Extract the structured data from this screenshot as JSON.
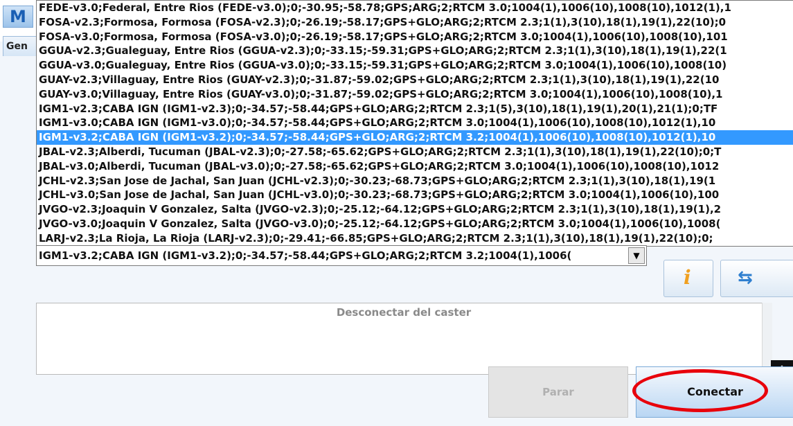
{
  "app": {
    "icon_letter": "M",
    "side_tab_label": "Gen"
  },
  "mountpoint_list": {
    "items": [
      "FEDE-v3.0;Federal, Entre Rios (FEDE-v3.0);0;-30.95;-58.78;GPS;ARG;2;RTCM 3.0;1004(1),1006(10),1008(10),1012(1),1",
      "FOSA-v2.3;Formosa, Formosa (FOSA-v2.3);0;-26.19;-58.17;GPS+GLO;ARG;2;RTCM 2.3;1(1),3(10),18(1),19(1),22(10);0",
      "FOSA-v3.0;Formosa, Formosa (FOSA-v3.0);0;-26.19;-58.17;GPS+GLO;ARG;2;RTCM 3.0;1004(1),1006(10),1008(10),101",
      "GGUA-v2.3;Gualeguay, Entre Rios (GGUA-v2.3);0;-33.15;-59.31;GPS+GLO;ARG;2;RTCM 2.3;1(1),3(10),18(1),19(1),22(1",
      "GGUA-v3.0;Gualeguay, Entre Rios (GGUA-v3.0);0;-33.15;-59.31;GPS+GLO;ARG;2;RTCM 3.0;1004(1),1006(10),1008(10)",
      "GUAY-v2.3;Villaguay, Entre Rios (GUAY-v2.3);0;-31.87;-59.02;GPS+GLO;ARG;2;RTCM 2.3;1(1),3(10),18(1),19(1),22(10",
      "GUAY-v3.0;Villaguay, Entre Rios (GUAY-v3.0);0;-31.87;-59.02;GPS+GLO;ARG;2;RTCM 3.0;1004(1),1006(10),1008(10),1",
      "IGM1-v2.3;CABA IGN (IGM1-v2.3);0;-34.57;-58.44;GPS+GLO;ARG;2;RTCM 2.3;1(5),3(10),18(1),19(1),20(1),21(1);0;TF",
      "IGM1-v3.0;CABA IGN (IGM1-v3.0);0;-34.57;-58.44;GPS+GLO;ARG;2;RTCM 3.0;1004(1),1006(10),1008(10),1012(1),10",
      "IGM1-v3.2;CABA IGN (IGM1-v3.2);0;-34.57;-58.44;GPS+GLO;ARG;2;RTCM 3.2;1004(1),1006(10),1008(10),1012(1),10",
      "JBAL-v2.3;Alberdi, Tucuman (JBAL-v2.3);0;-27.58;-65.62;GPS+GLO;ARG;2;RTCM 2.3;1(1),3(10),18(1),19(1),22(10);0;T",
      "JBAL-v3.0;Alberdi, Tucuman (JBAL-v3.0);0;-27.58;-65.62;GPS+GLO;ARG;2;RTCM 3.0;1004(1),1006(10),1008(10),1012",
      "JCHL-v2.3;San Jose de Jachal, San Juan (JCHL-v2.3);0;-30.23;-68.73;GPS+GLO;ARG;2;RTCM 2.3;1(1),3(10),18(1),19(1",
      "JCHL-v3.0;San Jose de Jachal, San Juan (JCHL-v3.0);0;-30.23;-68.73;GPS+GLO;ARG;2;RTCM 3.0;1004(1),1006(10),100",
      "JVGO-v2.3;Joaquin V Gonzalez, Salta (JVGO-v2.3);0;-25.12;-64.12;GPS+GLO;ARG;2;RTCM 2.3;1(1),3(10),18(1),19(1),2",
      "JVGO-v3.0;Joaquin V Gonzalez, Salta (JVGO-v3.0);0;-25.12;-64.12;GPS+GLO;ARG;2;RTCM 3.0;1004(1),1006(10),1008(",
      "LARJ-v2.3;La Rioja, La Rioja (LARJ-v2.3);0;-29.41;-66.85;GPS+GLO;ARG;2;RTCM 2.3;1(1),3(10),18(1),19(1),22(10);0;"
    ],
    "selected_index": 9
  },
  "combo": {
    "value": "IGM1-v3.2;CABA IGN (IGM1-v3.2);0;-34.57;-58.44;GPS+GLO;ARG;2;RTCM 3.2;1004(1),1006(",
    "arrow_glyph": "▼"
  },
  "info_button": {
    "icon": "info-icon",
    "glyph": "i"
  },
  "refresh_button": {
    "icon": "refresh-icon",
    "glyph": "⇆"
  },
  "log": {
    "message": "Desconectar del caster"
  },
  "keyboard_button": {
    "icon": "keyboard-toggle-icon",
    "glyph": "⇪"
  },
  "buttons": {
    "stop_label": "Parar",
    "connect_label": "Conectar"
  },
  "colors": {
    "selection": "#3399ff",
    "highlight": "#e8000b"
  }
}
